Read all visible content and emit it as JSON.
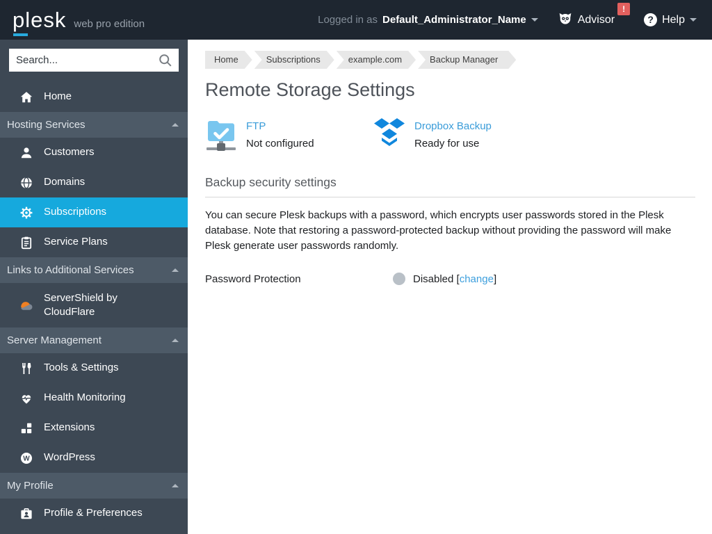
{
  "topbar": {
    "logo_text": "plesk",
    "edition": "web pro edition",
    "logged_in_prefix": "Logged in as",
    "admin_name": "Default_Administrator_Name",
    "advisor_label": "Advisor",
    "advisor_badge": "!",
    "help_label": "Help"
  },
  "icons": {
    "wordpress_glyph": "W",
    "help_glyph": "?"
  },
  "sidebar": {
    "search_placeholder": "Search...",
    "items": [
      {
        "label": "Home",
        "icon": "home-icon",
        "type": "item"
      },
      {
        "label": "Hosting Services",
        "type": "section"
      },
      {
        "label": "Customers",
        "icon": "user-icon",
        "type": "item"
      },
      {
        "label": "Domains",
        "icon": "globe-icon",
        "type": "item"
      },
      {
        "label": "Subscriptions",
        "icon": "gear-icon",
        "type": "item",
        "active": true
      },
      {
        "label": "Service Plans",
        "icon": "clipboard-icon",
        "type": "item"
      },
      {
        "label": "Links to Additional Services",
        "type": "section"
      },
      {
        "label": "ServerShield by CloudFlare",
        "icon": "cloudflare-icon",
        "type": "item"
      },
      {
        "label": "Server Management",
        "type": "section"
      },
      {
        "label": "Tools & Settings",
        "icon": "tools-icon",
        "type": "item"
      },
      {
        "label": "Health Monitoring",
        "icon": "heart-pulse-icon",
        "type": "item"
      },
      {
        "label": "Extensions",
        "icon": "blocks-icon",
        "type": "item"
      },
      {
        "label": "WordPress",
        "icon": "wordpress-icon",
        "type": "item"
      },
      {
        "label": "My Profile",
        "type": "section"
      },
      {
        "label": "Profile & Preferences",
        "icon": "id-card-icon",
        "type": "item"
      }
    ]
  },
  "breadcrumb": [
    "Home",
    "Subscriptions",
    "example.com",
    "Backup Manager"
  ],
  "main": {
    "title": "Remote Storage Settings",
    "storage_options": [
      {
        "name": "FTP",
        "status": "Not configured",
        "icon": "ftp-folder-icon"
      },
      {
        "name": "Dropbox Backup",
        "status": "Ready for use",
        "icon": "dropbox-icon"
      }
    ],
    "security": {
      "heading": "Backup security settings",
      "description": "You can secure Plesk backups with a password, which encrypts user passwords stored in the Plesk database. Note that restoring a password-protected backup without providing the password will make Plesk generate user passwords randomly.",
      "password_label": "Password Protection",
      "status": "Disabled",
      "bracket_left": "[",
      "change_label": "change",
      "bracket_right": "]"
    }
  },
  "colors": {
    "topbar_bg": "#1e2630",
    "sidebar_bg": "#3d4854",
    "section_bg": "#4d5a67",
    "active_item_bg": "#16a9dd",
    "brand_accent": "#28aade",
    "link_blue": "#3a9cd9",
    "badge_red": "#e2605e",
    "disabled_dot": "#b9c0c7",
    "breadcrumb_bg": "#e8e8e8"
  }
}
